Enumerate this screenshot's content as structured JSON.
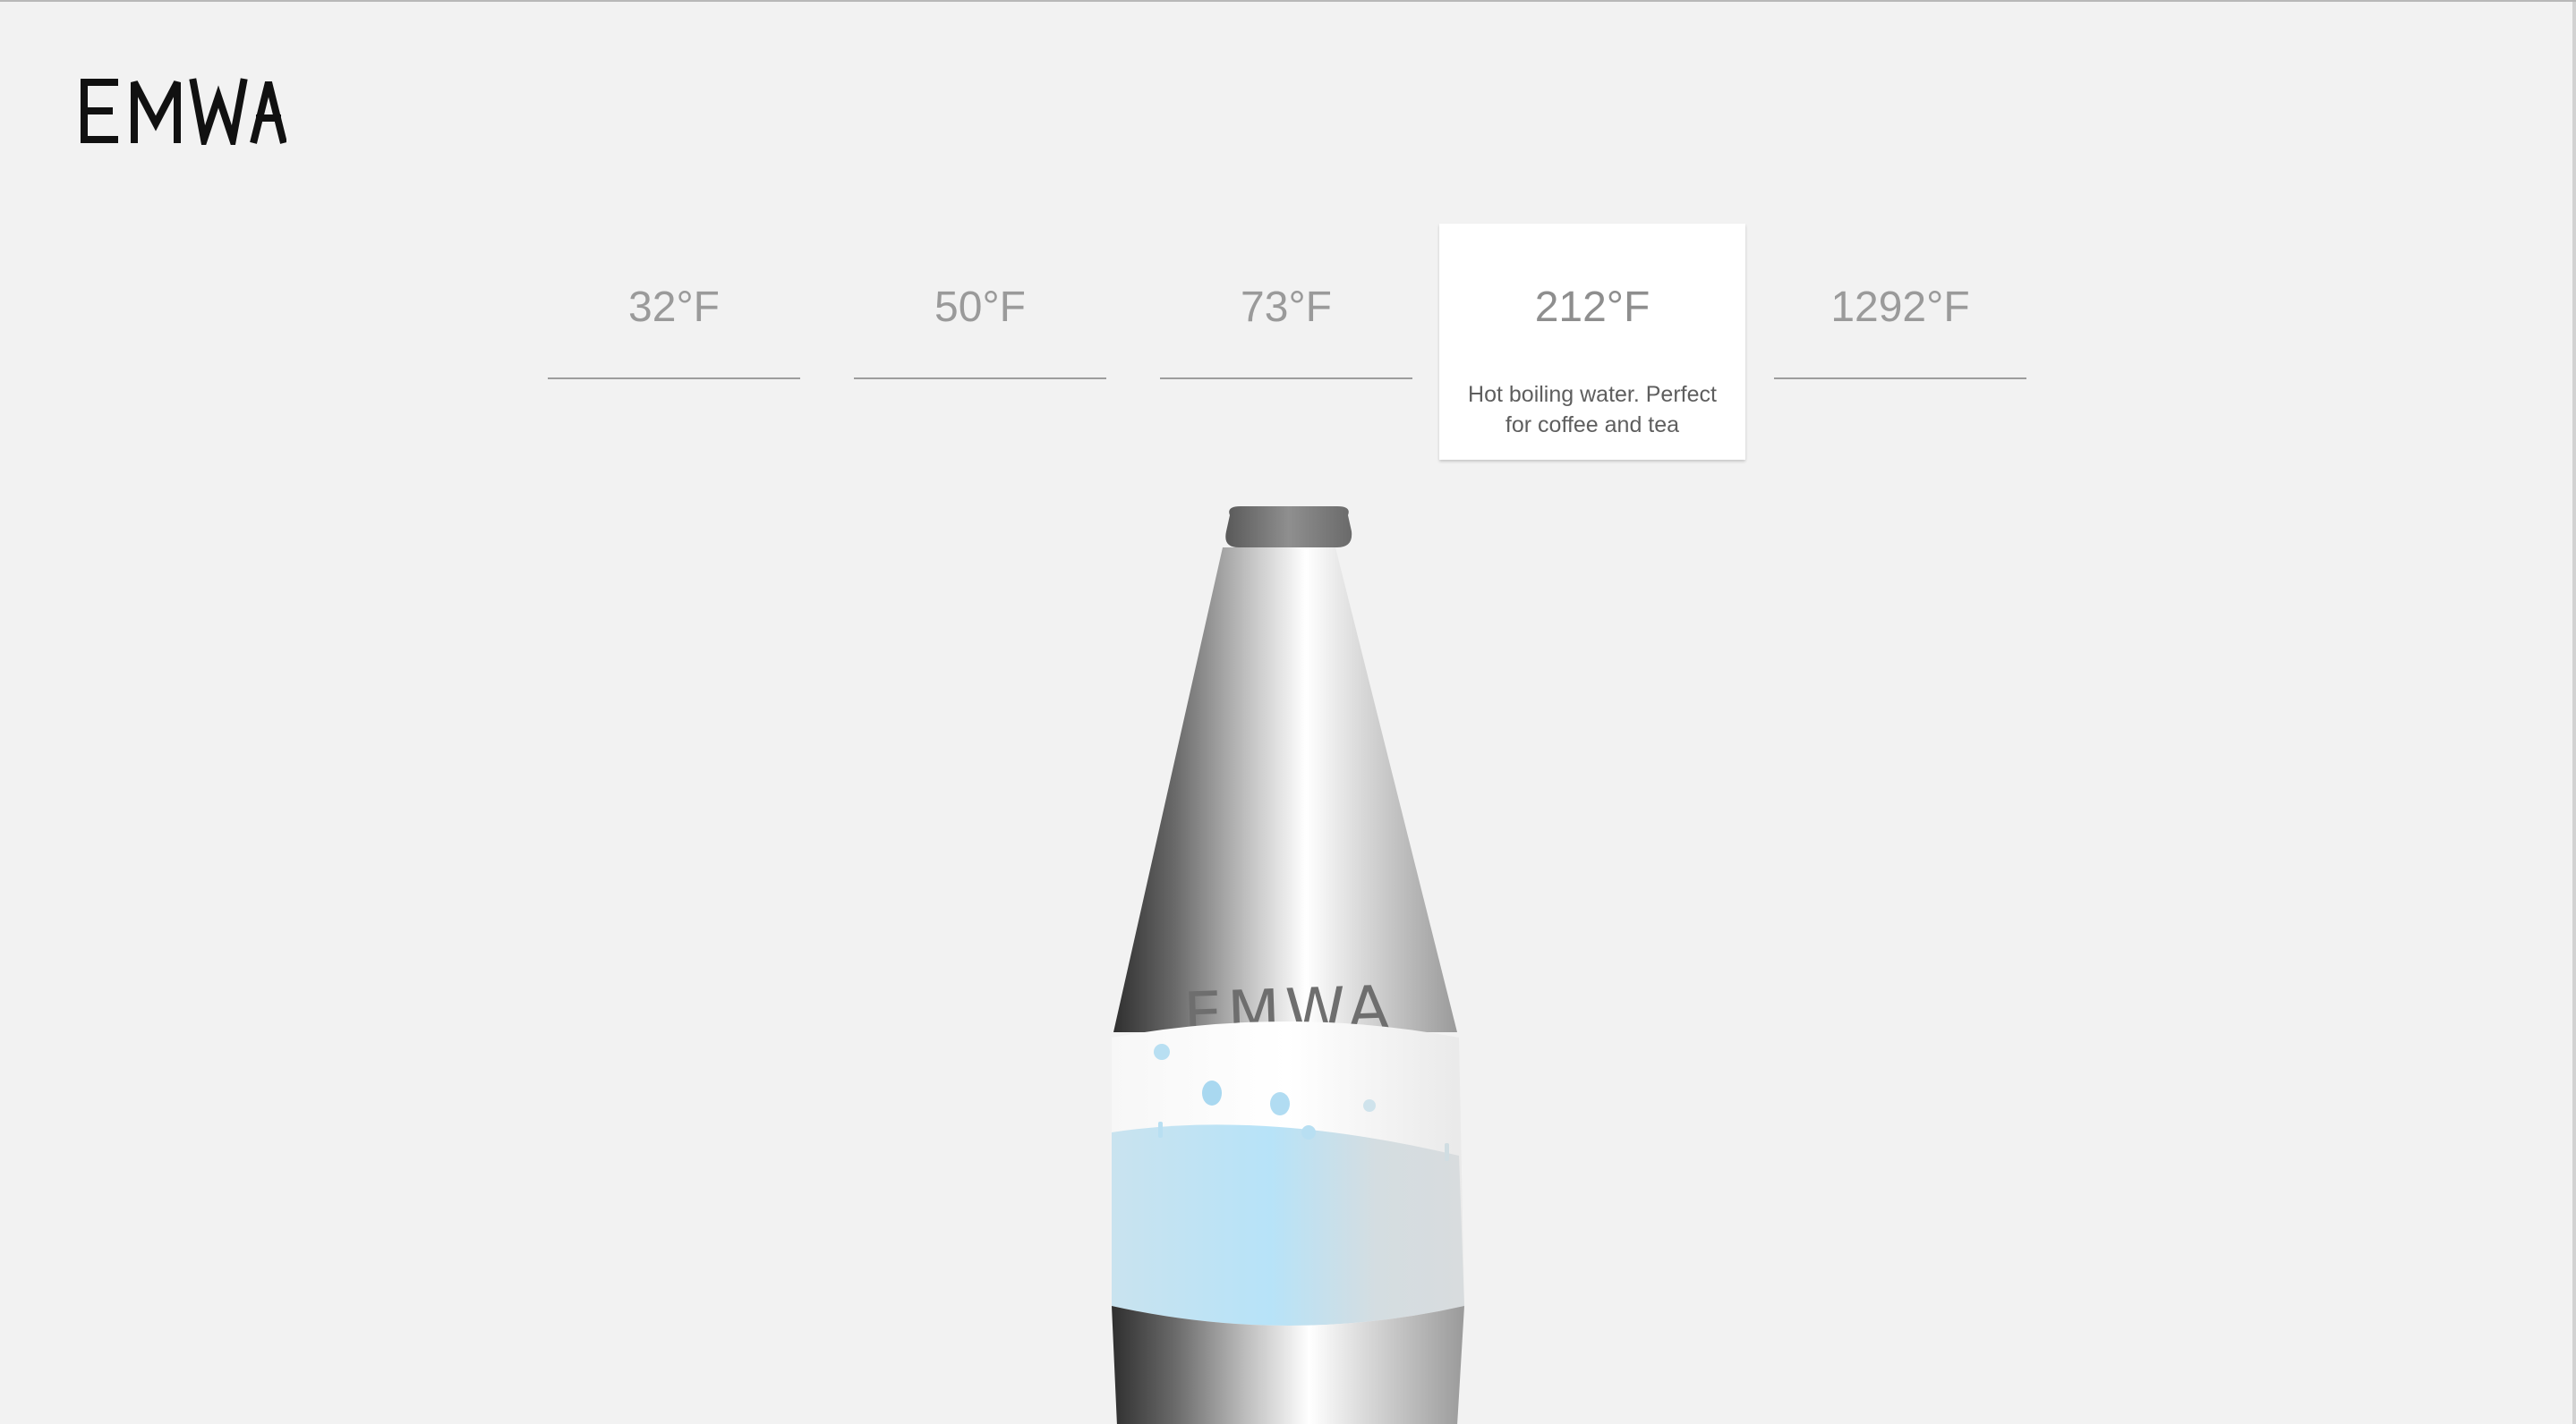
{
  "brand": {
    "logo_text": "EMWA"
  },
  "temperature_tabs": [
    {
      "label": "32°F",
      "description": ""
    },
    {
      "label": "50°F",
      "description": ""
    },
    {
      "label": "73°F",
      "description": ""
    },
    {
      "label": "212°F",
      "description": "Hot boiling water. Perfect for coffee and tea"
    },
    {
      "label": "1292°F",
      "description": ""
    }
  ],
  "selected_tab": "212°F",
  "bottle": {
    "label_text": "EMWA",
    "body_color": "#c8c8c8",
    "water_color": "#b8e2f5",
    "cap_color": "#6e6e6e"
  },
  "colors": {
    "background": "#f2f2f2",
    "tab_text": "#9a9a9a",
    "active_tab_bg": "#ffffff"
  }
}
